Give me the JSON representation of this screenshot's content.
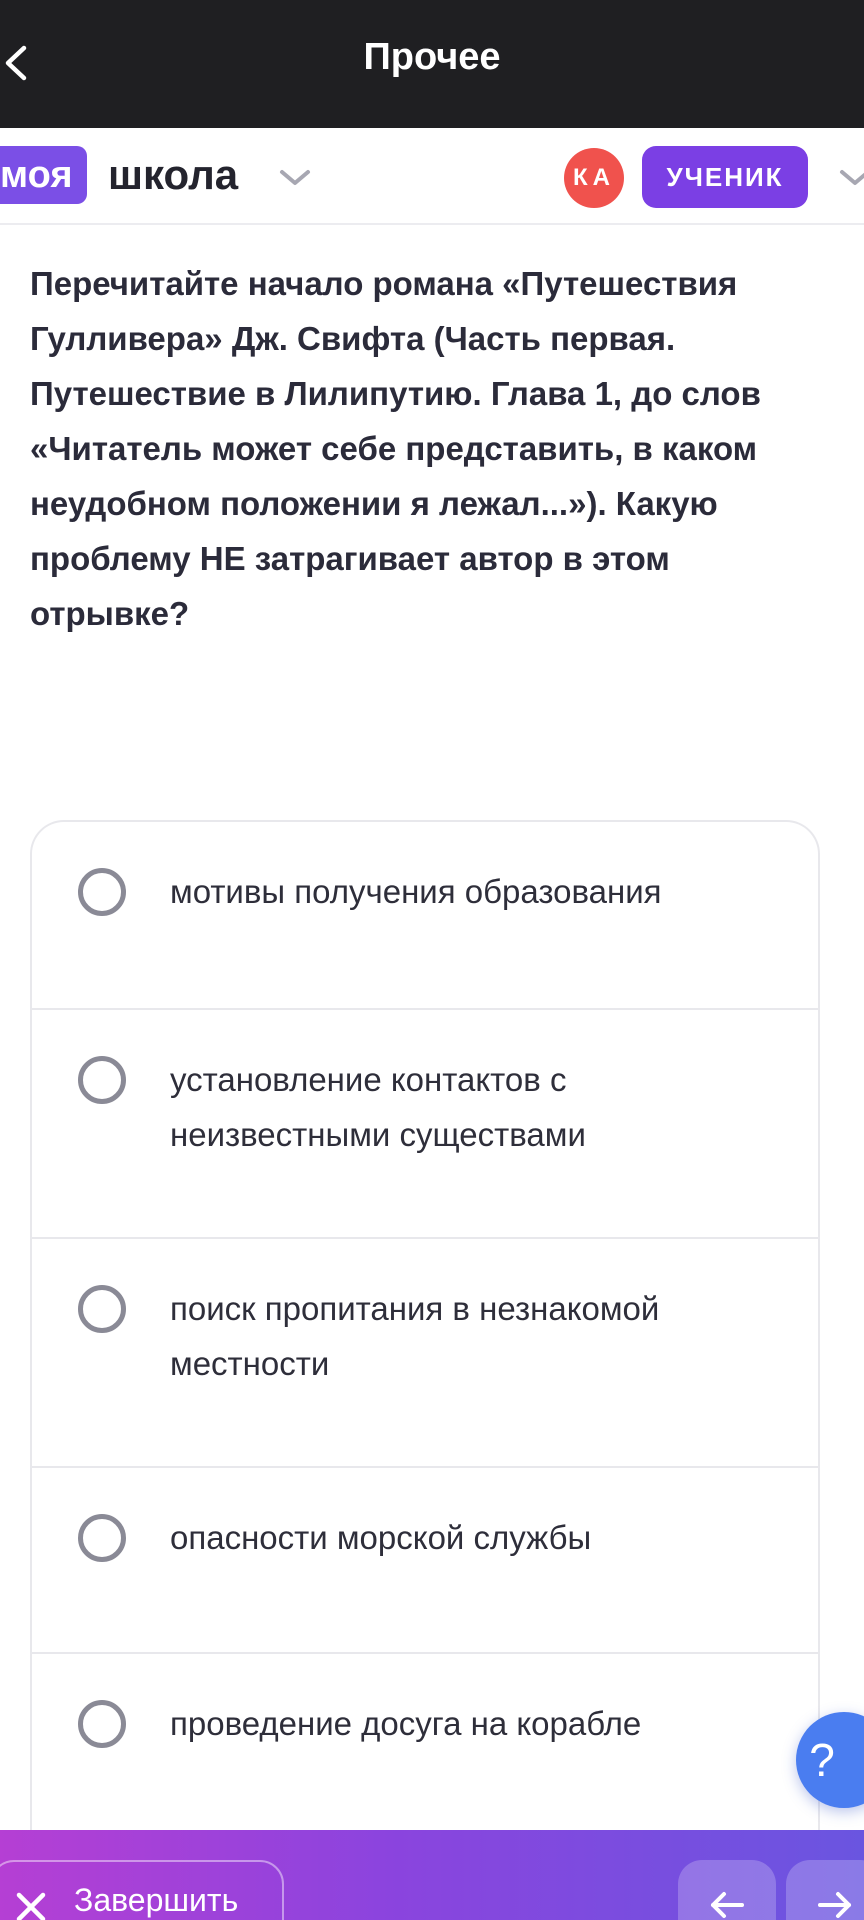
{
  "topbar": {
    "title": "Прочее"
  },
  "school_header": {
    "logo_part1": "моя",
    "logo_part2": "школа",
    "avatar_initials": "КА",
    "role": "УЧЕНИК"
  },
  "question": {
    "text": "Перечитайте начало романа «Путешествия Гулливера» Дж. Свифта (Часть первая. Путешествие в Лилипутию. Глава 1, до слов «Читатель может себе представить, в каком неудобном положении я лежал...»). Какую проблему НЕ затрагивает автор в этом отрывке?"
  },
  "options": [
    {
      "label": "мотивы получения образования",
      "selected": false
    },
    {
      "label": "установление контактов с неизвестными существами",
      "selected": false
    },
    {
      "label": "поиск пропитания в незнакомой местности",
      "selected": false
    },
    {
      "label": "опасности морской службы",
      "selected": false
    },
    {
      "label": "проведение досуга на корабле",
      "selected": false
    }
  ],
  "help_button": {
    "label": "?"
  },
  "bottom_bar": {
    "finish_label": "Завершить"
  },
  "colors": {
    "topbar_bg": "#1f1f22",
    "brand_purple": "#7b3fe4",
    "avatar_red": "#f0524d",
    "help_blue": "#4a7df0",
    "bottom_gradient_start": "#b53fd4",
    "bottom_gradient_end": "#6a55e0"
  },
  "icons": {
    "back": "chevron-left-icon",
    "school_dropdown": "chevron-down-icon",
    "role_dropdown": "chevron-down-icon",
    "finish": "close-icon",
    "prev": "arrow-left-icon",
    "next": "arrow-right-icon"
  }
}
